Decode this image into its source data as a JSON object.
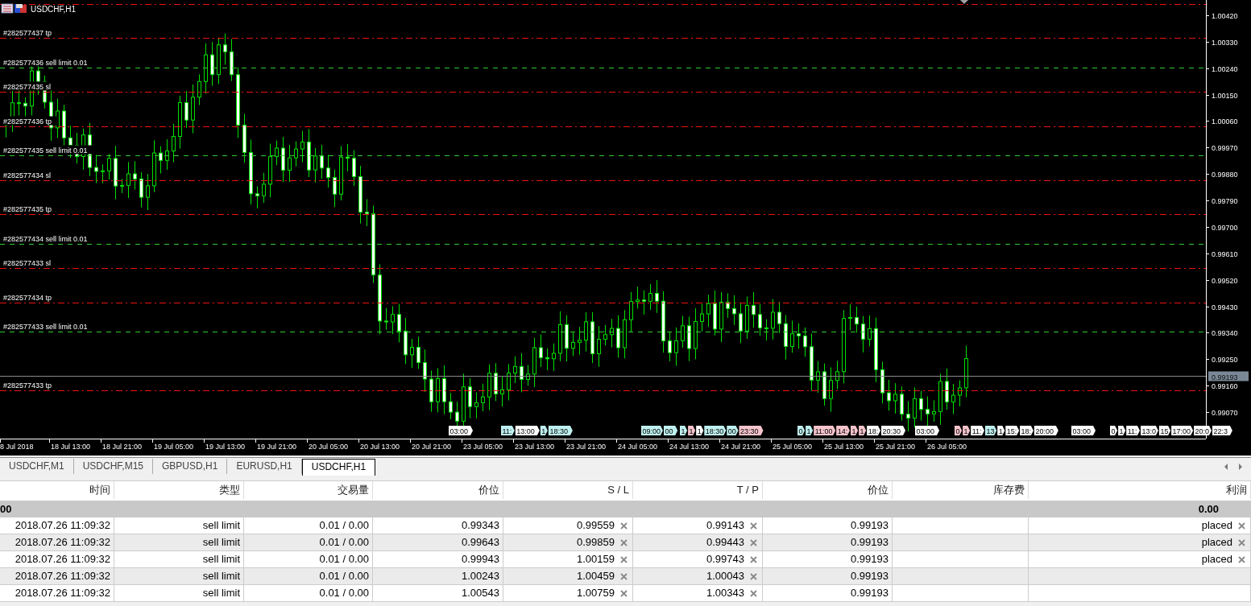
{
  "chart": {
    "title": "USDCHF,H1",
    "price_axis": [
      "1.00420",
      "1.00330",
      "1.00240",
      "1.00150",
      "1.00060",
      "0.99970",
      "0.99880",
      "0.99790",
      "0.99700",
      "0.99610",
      "0.99520",
      "0.99430",
      "0.99340",
      "0.99250",
      "0.99160",
      "0.99070"
    ],
    "bid": {
      "label": "0.99193"
    },
    "time_axis": [
      "8 Jul 2018",
      "18 Jul 13:00",
      "18 Jul 21:00",
      "19 Jul 05:00",
      "19 Jul 13:00",
      "19 Jul 21:00",
      "20 Jul 05:00",
      "20 Jul 13:00",
      "20 Jul 21:00",
      "23 Jul 05:00",
      "23 Jul 13:00",
      "23 Jul 21:00",
      "24 Jul 05:00",
      "24 Jul 13:00",
      "24 Jul 21:00",
      "25 Jul 05:00",
      "25 Jul 13:00",
      "25 Jul 21:00",
      "26 Jul 05:00"
    ],
    "order_lines": [
      {
        "kind": "sl"
      },
      {
        "label": "#282577437 tp",
        "kind": "tp"
      },
      {
        "label": "#282577436 sell limit 0.01",
        "kind": "entry"
      },
      {
        "label": "#282577435 sl",
        "kind": "sl"
      },
      {
        "label": "#282577436 tp",
        "kind": "tp"
      },
      {
        "label": "#282577435 sell limit 0.01",
        "kind": "entry"
      },
      {
        "label": "#282577434 sl",
        "kind": "sl"
      },
      {
        "label": "#282577435 tp",
        "kind": "tp"
      },
      {
        "label": "#282577434 sell limit 0.01",
        "kind": "entry"
      },
      {
        "label": "#282577433 sl",
        "kind": "sl"
      },
      {
        "label": "#282577434 tp",
        "kind": "tp"
      },
      {
        "label": "#282577433 sell limit 0.01",
        "kind": "entry"
      },
      {
        "label": "#282577433 tp",
        "kind": "tp"
      }
    ],
    "event_markers": [
      {
        "text": "03:00",
        "color": "#ffffff"
      },
      {
        "text": "11:",
        "color": "#bff0f0"
      },
      {
        "text": "13:00",
        "color": "#ffffff"
      },
      {
        "text": "1",
        "color": "#bff0f0"
      },
      {
        "text": "18:30",
        "color": "#bff0f0"
      },
      {
        "text": "09:00",
        "color": "#bff0f0"
      },
      {
        "text": "00",
        "color": "#bff0f0"
      },
      {
        "text": "1",
        "color": "#bff0f0"
      },
      {
        "text": "1",
        "color": "#f6c4cc"
      },
      {
        "text": "1",
        "color": "#ffffff"
      },
      {
        "text": "18:30",
        "color": "#bff0f0"
      },
      {
        "text": "00",
        "color": "#bff0f0"
      },
      {
        "text": "23:30",
        "color": "#f6c4cc"
      },
      {
        "text": "0",
        "color": "#bff0f0"
      },
      {
        "text": "1",
        "color": "#bff0f0"
      },
      {
        "text": "11:00",
        "color": "#f6c4cc"
      },
      {
        "text": "14:",
        "color": "#f6c4cc"
      },
      {
        "text": "1",
        "color": "#f6c4cc"
      },
      {
        "text": "1",
        "color": "#f6c4cc"
      },
      {
        "text": "18:",
        "color": "#ffffff"
      },
      {
        "text": "20:30",
        "color": "#ffffff"
      },
      {
        "text": "03:00",
        "color": "#ffffff"
      },
      {
        "text": "0",
        "color": "#f6c4cc"
      },
      {
        "text": "1",
        "color": "#f6c4cc"
      },
      {
        "text": "11:",
        "color": "#ffffff"
      },
      {
        "text": "13",
        "color": "#bff0f0"
      },
      {
        "text": "1",
        "color": "#ffffff"
      },
      {
        "text": "15:",
        "color": "#ffffff"
      },
      {
        "text": "18:",
        "color": "#ffffff"
      },
      {
        "text": "20:00",
        "color": "#ffffff"
      },
      {
        "text": "03:00",
        "color": "#ffffff"
      },
      {
        "text": "0",
        "color": "#ffffff"
      },
      {
        "text": "1",
        "color": "#ffffff"
      },
      {
        "text": "11:",
        "color": "#ffffff"
      },
      {
        "text": "13:0",
        "color": "#ffffff"
      },
      {
        "text": "15",
        "color": "#ffffff"
      },
      {
        "text": "17:00",
        "color": "#ffffff"
      },
      {
        "text": "20:0",
        "color": "#ffffff"
      },
      {
        "text": "22:3",
        "color": "#ffffff"
      }
    ]
  },
  "tabs": [
    {
      "label": "USDCHF,M1",
      "selected": false
    },
    {
      "label": "USDCHF,M15",
      "selected": false
    },
    {
      "label": "GBPUSD,H1",
      "selected": false
    },
    {
      "label": "EURUSD,H1",
      "selected": false
    },
    {
      "label": "USDCHF,H1",
      "selected": true
    }
  ],
  "table": {
    "columns": [
      "时间",
      "类型",
      "交易量",
      "价位",
      "S / L",
      "T / P",
      "价位",
      "库存费",
      "利润"
    ],
    "summary": {
      "balance": "00",
      "profit": "0.00"
    },
    "rows": [
      {
        "time": "2018.07.26 11:09:32",
        "type": "sell limit",
        "volume": "0.01 / 0.00",
        "price": "0.99343",
        "sl": "0.99559",
        "tp": "0.99143",
        "current_price": "0.99193",
        "profit": "placed"
      },
      {
        "time": "2018.07.26 11:09:32",
        "type": "sell limit",
        "volume": "0.01 / 0.00",
        "price": "0.99643",
        "sl": "0.99859",
        "tp": "0.99443",
        "current_price": "0.99193",
        "profit": "placed"
      },
      {
        "time": "2018.07.26 11:09:32",
        "type": "sell limit",
        "volume": "0.01 / 0.00",
        "price": "0.99943",
        "sl": "1.00159",
        "tp": "0.99743",
        "current_price": "0.99193",
        "profit": "placed"
      },
      {
        "time": "2018.07.26 11:09:32",
        "type": "sell limit",
        "volume": "0.01 / 0.00",
        "price": "1.00243",
        "sl": "1.00459",
        "tp": "1.00043",
        "current_price": "0.99193"
      },
      {
        "time": "2018.07.26 11:09:32",
        "type": "sell limit",
        "volume": "0.01 / 0.00",
        "price": "1.00543",
        "sl": "1.00759",
        "tp": "1.00343",
        "current_price": "0.99193"
      }
    ]
  }
}
